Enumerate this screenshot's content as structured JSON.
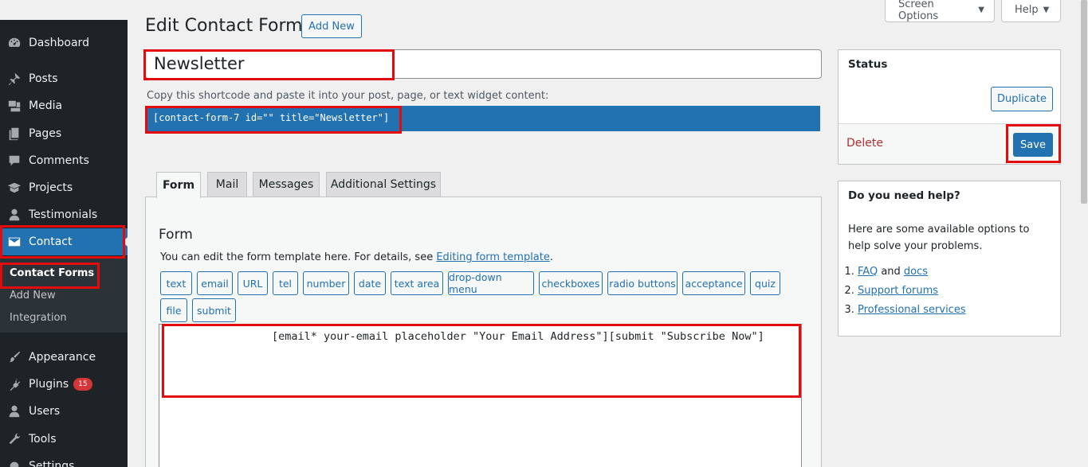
{
  "sidebar": {
    "items": [
      {
        "label": "Dashboard",
        "icon": "dashboard-icon"
      },
      {
        "label": "Posts",
        "icon": "pushpin-icon"
      },
      {
        "label": "Media",
        "icon": "media-icon"
      },
      {
        "label": "Pages",
        "icon": "pages-icon"
      },
      {
        "label": "Comments",
        "icon": "comments-icon"
      },
      {
        "label": "Projects",
        "icon": "portfolio-icon"
      },
      {
        "label": "Testimonials",
        "icon": "user-icon"
      },
      {
        "label": "Contact",
        "icon": "envelope-icon"
      },
      {
        "label": "Appearance",
        "icon": "paintbrush-icon"
      },
      {
        "label": "Plugins",
        "icon": "plugin-icon",
        "badge": "15"
      },
      {
        "label": "Users",
        "icon": "users-icon"
      },
      {
        "label": "Tools",
        "icon": "wrench-icon"
      },
      {
        "label": "Settings",
        "icon": "settings-icon"
      }
    ],
    "submenu": [
      "Contact Forms",
      "Add New",
      "Integration"
    ]
  },
  "header": {
    "screen_options": "Screen Options",
    "help": "Help",
    "title": "Edit Contact Form",
    "add_new": "Add New"
  },
  "editor": {
    "form_title": "Newsletter",
    "shortcode_hint": "Copy this shortcode and paste it into your post, page, or text widget content:",
    "shortcode": "[contact-form-7 id=\"\" title=\"Newsletter\"]"
  },
  "tabs": [
    "Form",
    "Mail",
    "Messages",
    "Additional Settings"
  ],
  "form_panel": {
    "heading": "Form",
    "desc_prefix": "You can edit the form template here. For details, see ",
    "desc_link": "Editing form template",
    "desc_suffix": ".",
    "tag_buttons": [
      "text",
      "email",
      "URL",
      "tel",
      "number",
      "date",
      "text area",
      "drop-down menu",
      "checkboxes",
      "radio buttons",
      "acceptance",
      "quiz",
      "file",
      "submit"
    ],
    "template": "[email* your-email placeholder \"Your Email Address\"][submit \"Subscribe Now\"]"
  },
  "status_box": {
    "title": "Status",
    "duplicate": "Duplicate",
    "delete": "Delete",
    "save": "Save"
  },
  "help_box": {
    "title": "Do you need help?",
    "text": "Here are some available options to help solve your problems.",
    "faq": "FAQ",
    "and": " and ",
    "docs": "docs",
    "support": "Support forums",
    "professional": "Professional services"
  },
  "colors": {
    "sidebar_bg": "#1d2327",
    "accent": "#2271b1",
    "highlight": "#e30b0b",
    "delete": "#b32d2e"
  }
}
